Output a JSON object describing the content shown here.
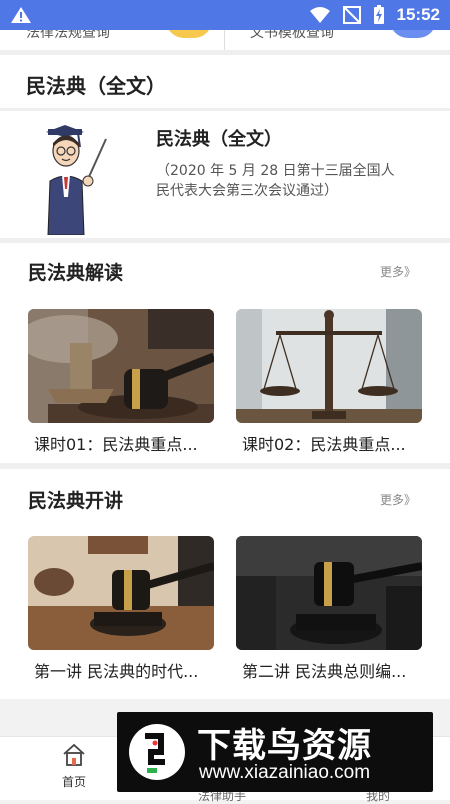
{
  "statusbar": {
    "time": "15:52"
  },
  "top_strip": {
    "left_text": "法律法规查询",
    "right_text": "文书模板查询"
  },
  "fulltext_section": {
    "header": "民法典（全文）",
    "card_title": "民法典（全文）",
    "card_desc": "（2020 年 5 月 28 日第十三届全国人民代表大会第三次会议通过）"
  },
  "interpret": {
    "header": "民法典解读",
    "more": "更多》",
    "items": [
      {
        "caption": "课时01：民法典重点..."
      },
      {
        "caption": "课时02：民法典重点..."
      }
    ]
  },
  "lectures": {
    "header": "民法典开讲",
    "more": "更多》",
    "items": [
      {
        "caption": "第一讲 民法典的时代..."
      },
      {
        "caption": "第二讲 民法典总则编..."
      }
    ]
  },
  "nav": {
    "home": "首页",
    "tab2": "法律助手",
    "tab3": "我的"
  },
  "watermark": {
    "brand": "下载鸟资源",
    "url": "www.xiazainiao.com"
  },
  "colors": {
    "status_bar": "#4f77e6",
    "page_bg": "#f2f2f2"
  }
}
